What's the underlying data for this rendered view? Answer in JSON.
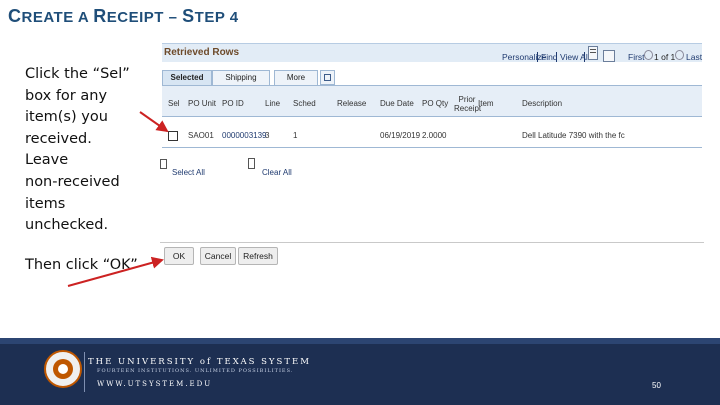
{
  "slide": {
    "title": {
      "c1": "C",
      "rest1": "REATE A ",
      "c2": "R",
      "rest2": "ECEIPT",
      "dash": " – ",
      "c3": "S",
      "rest3": "TEP 4"
    },
    "instruction_lines": [
      "Click the “Sel”",
      "box for any",
      "item(s) you",
      "received.",
      "Leave",
      "non-received",
      "items",
      "unchecked."
    ],
    "then_text": "Then click “OK”"
  },
  "panel": {
    "title": "Retrieved Rows",
    "toolbar": {
      "personalize": "Personalize",
      "find": "Find",
      "view_all": "View All",
      "first": "First",
      "page_info": "1 of 1",
      "last": "Last"
    },
    "tabs": [
      "Selected Rows",
      "Shipping Related",
      "More Details"
    ],
    "columns": [
      "Sel",
      "PO Unit",
      "PO ID",
      "Line",
      "Sched",
      "Release",
      "Due Date",
      "PO Qty",
      "Prior Receipt",
      "Item",
      "Description"
    ],
    "row": {
      "sel": false,
      "po_unit": "SAO01",
      "po_id": "0000003139",
      "line": "3",
      "sched": "1",
      "release": "",
      "due_date": "06/19/2019",
      "po_qty": "2.0000",
      "prior_receipt": "",
      "item": "",
      "description": "Dell Latitude 7390 with the fc"
    },
    "select_all": "Select All",
    "clear_all": "Clear All",
    "buttons": {
      "ok": "OK",
      "cancel": "Cancel",
      "refresh": "Refresh"
    }
  },
  "footer": {
    "university": "THE UNIVERSITY of TEXAS SYSTEM",
    "tagline": "FOURTEEN INSTITUTIONS. UNLIMITED POSSIBILITIES.",
    "url": "WWW.UTSYSTEM.EDU",
    "page_number": "50"
  },
  "colors": {
    "title": "#1f4e79",
    "arrow": "#cc2222",
    "footer": "#1d2f52",
    "panel_header": "#e2ecf6"
  }
}
